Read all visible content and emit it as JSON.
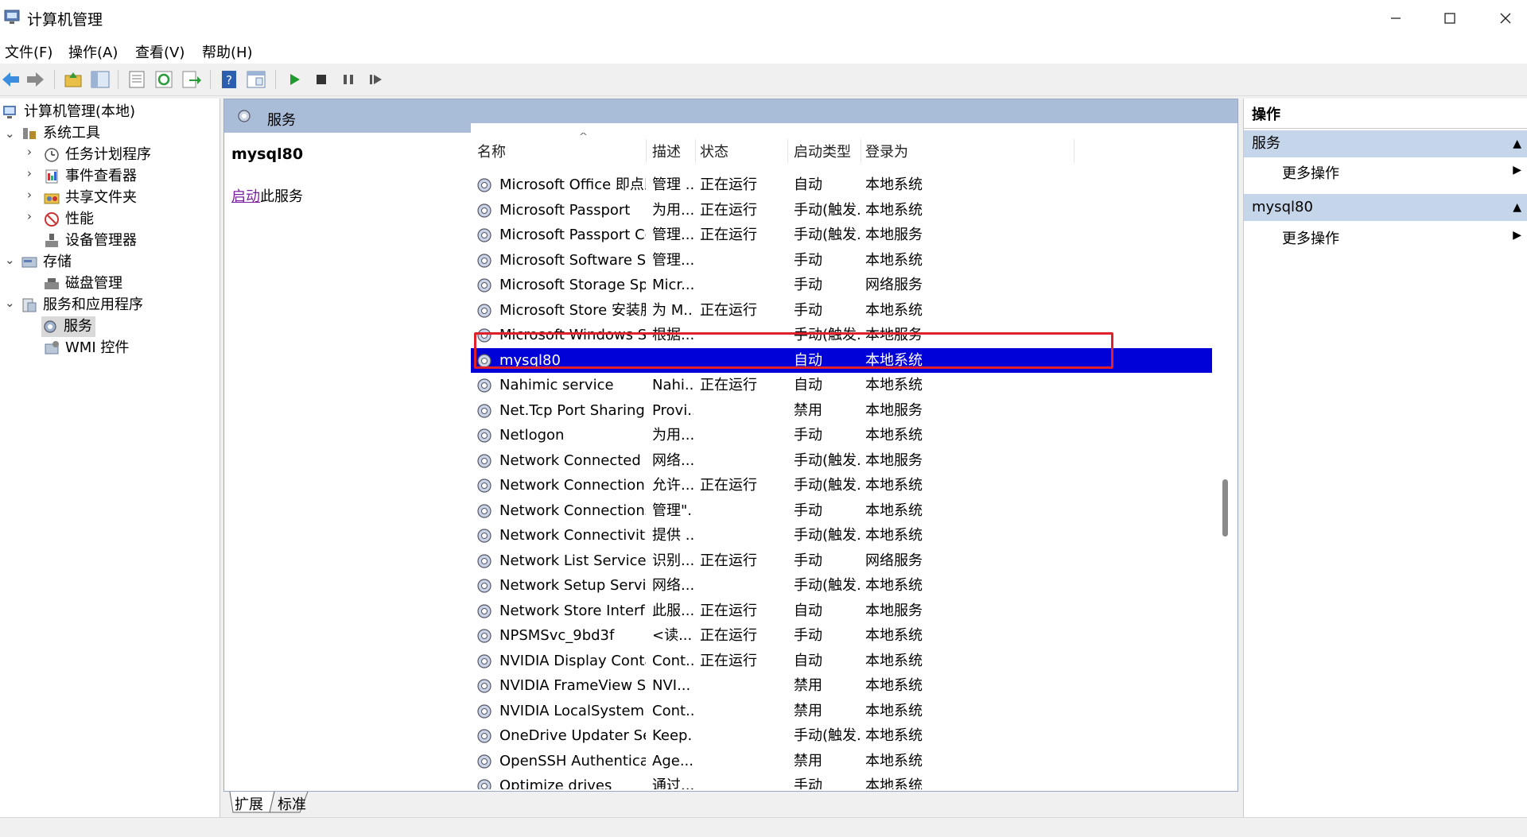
{
  "window": {
    "title": "计算机管理",
    "min_icon": "minimize-icon",
    "max_icon": "maximize-icon",
    "close_icon": "close-icon"
  },
  "menu": [
    "文件(F)",
    "操作(A)",
    "查看(V)",
    "帮助(H)"
  ],
  "toolbar": [
    "back-icon",
    "forward-icon",
    "up-folder-icon",
    "show-hide-tree-icon",
    "properties-icon",
    "refresh-icon",
    "export-icon",
    "help-icon",
    "view-icon",
    "start-service-icon",
    "stop-service-icon",
    "pause-service-icon",
    "resume-service-icon"
  ],
  "tree": {
    "root": "计算机管理(本地)",
    "system_tools": "系统工具",
    "task_scheduler": "任务计划程序",
    "event_viewer": "事件查看器",
    "shared_folders": "共享文件夹",
    "performance": "性能",
    "device_manager": "设备管理器",
    "storage": "存储",
    "disk_mgmt": "磁盘管理",
    "services_apps": "服务和应用程序",
    "services": "服务",
    "wmi": "WMI 控件"
  },
  "center": {
    "header": "服务",
    "selected_name": "mysql80",
    "start_link": "启动",
    "start_suffix": "此服务",
    "columns": {
      "name": "名称",
      "desc": "描述",
      "status": "状态",
      "startup": "启动类型",
      "logon": "登录为"
    },
    "sort_indicator": "^",
    "tabs": [
      "扩展",
      "标准"
    ]
  },
  "services": [
    {
      "name": "Microsoft Office 即点即用...",
      "desc": "管理 ...",
      "status": "正在运行",
      "startup": "自动",
      "logon": "本地系统"
    },
    {
      "name": "Microsoft Passport",
      "desc": "为用...",
      "status": "正在运行",
      "startup": "手动(触发...",
      "logon": "本地系统"
    },
    {
      "name": "Microsoft Passport Container",
      "desc": "管理...",
      "status": "正在运行",
      "startup": "手动(触发...",
      "logon": "本地服务"
    },
    {
      "name": "Microsoft Software Shado...",
      "desc": "管理...",
      "status": "",
      "startup": "手动",
      "logon": "本地系统"
    },
    {
      "name": "Microsoft Storage Spaces S...",
      "desc": "Micr...",
      "status": "",
      "startup": "手动",
      "logon": "网络服务"
    },
    {
      "name": "Microsoft Store 安装服务",
      "desc": "为 M...",
      "status": "正在运行",
      "startup": "手动",
      "logon": "本地系统"
    },
    {
      "name": "Microsoft Windows SMS 路...",
      "desc": "根据...",
      "status": "",
      "startup": "手动(触发...",
      "logon": "本地服务"
    },
    {
      "name": "mysql80",
      "desc": "",
      "status": "",
      "startup": "自动",
      "logon": "本地系统"
    },
    {
      "name": "Nahimic service",
      "desc": "Nahi...",
      "status": "正在运行",
      "startup": "自动",
      "logon": "本地系统"
    },
    {
      "name": "Net.Tcp Port Sharing Service",
      "desc": "Provi...",
      "status": "",
      "startup": "禁用",
      "logon": "本地服务"
    },
    {
      "name": "Netlogon",
      "desc": "为用...",
      "status": "",
      "startup": "手动",
      "logon": "本地系统"
    },
    {
      "name": "Network Connected Devic...",
      "desc": "网络...",
      "status": "",
      "startup": "手动(触发...",
      "logon": "本地服务"
    },
    {
      "name": "Network Connection Broker",
      "desc": "允许...",
      "status": "正在运行",
      "startup": "手动(触发...",
      "logon": "本地系统"
    },
    {
      "name": "Network Connections",
      "desc": "管理\"...",
      "status": "",
      "startup": "手动",
      "logon": "本地系统"
    },
    {
      "name": "Network Connectivity Assis...",
      "desc": "提供 ...",
      "status": "",
      "startup": "手动(触发...",
      "logon": "本地系统"
    },
    {
      "name": "Network List Service",
      "desc": "识别...",
      "status": "正在运行",
      "startup": "手动",
      "logon": "网络服务"
    },
    {
      "name": "Network Setup Service",
      "desc": "网络...",
      "status": "",
      "startup": "手动(触发...",
      "logon": "本地系统"
    },
    {
      "name": "Network Store Interface Se...",
      "desc": "此服...",
      "status": "正在运行",
      "startup": "自动",
      "logon": "本地服务"
    },
    {
      "name": "NPSMSvc_9bd3f",
      "desc": "<读...",
      "status": "正在运行",
      "startup": "手动",
      "logon": "本地系统"
    },
    {
      "name": "NVIDIA Display Container LS",
      "desc": "Cont...",
      "status": "正在运行",
      "startup": "自动",
      "logon": "本地系统"
    },
    {
      "name": "NVIDIA FrameView SDK se...",
      "desc": "NVI...",
      "status": "",
      "startup": "禁用",
      "logon": "本地系统"
    },
    {
      "name": "NVIDIA LocalSystem Conta...",
      "desc": "Cont...",
      "status": "",
      "startup": "禁用",
      "logon": "本地系统"
    },
    {
      "name": "OneDrive Updater Service",
      "desc": "Keep...",
      "status": "",
      "startup": "手动(触发...",
      "logon": "本地系统"
    },
    {
      "name": "OpenSSH Authentication ...",
      "desc": "Age...",
      "status": "",
      "startup": "禁用",
      "logon": "本地系统"
    },
    {
      "name": "Optimize drives",
      "desc": "通过...",
      "status": "",
      "startup": "手动",
      "logon": "本地系统"
    }
  ],
  "actions": {
    "title": "操作",
    "section1": "服务",
    "section1_more": "更多操作",
    "section2": "mysql80",
    "section2_more": "更多操作"
  },
  "colors": {
    "selection": "#0000d8",
    "highlight_box": "#e0202b",
    "header_blue": "#a9bdd8",
    "action_section": "#c5d5ea"
  }
}
